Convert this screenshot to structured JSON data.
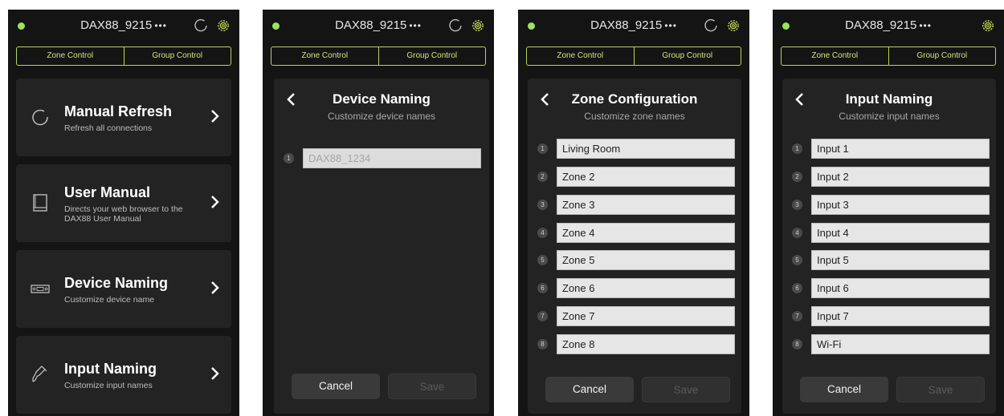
{
  "app": {
    "device_name": "DAX88_9215",
    "more": "•••",
    "status_color": "#9be35a",
    "accent_color": "#c8dd55",
    "tabs": [
      "Zone Control",
      "Group Control"
    ]
  },
  "menu": {
    "items": [
      {
        "title": "Manual Refresh",
        "desc": "Refresh all connections",
        "icon": "refresh-icon"
      },
      {
        "title": "User Manual",
        "desc": "Directs your web browser to the DAX88 User Manual",
        "icon": "book-icon"
      },
      {
        "title": "Device Naming",
        "desc": "Customize device name",
        "icon": "device-icon"
      },
      {
        "title": "Input Naming",
        "desc": "Customize input names",
        "icon": "cable-icon"
      }
    ]
  },
  "device_naming": {
    "title": "Device Naming",
    "subtitle": "Customize device names",
    "field_number": "1",
    "placeholder": "DAX88_1234",
    "cancel": "Cancel",
    "save": "Save"
  },
  "zone_config": {
    "title": "Zone Configuration",
    "subtitle": "Customize zone names",
    "zones": [
      "Living Room",
      "Zone 2",
      "Zone 3",
      "Zone 4",
      "Zone 5",
      "Zone 6",
      "Zone 7",
      "Zone 8"
    ],
    "cancel": "Cancel",
    "save": "Save"
  },
  "input_naming": {
    "title": "Input Naming",
    "subtitle": "Customize input names",
    "inputs": [
      "Input 1",
      "Input 2",
      "Input 3",
      "Input 4",
      "Input 5",
      "Input 6",
      "Input 7",
      "Wi-Fi"
    ],
    "cancel": "Cancel",
    "save": "Save"
  }
}
